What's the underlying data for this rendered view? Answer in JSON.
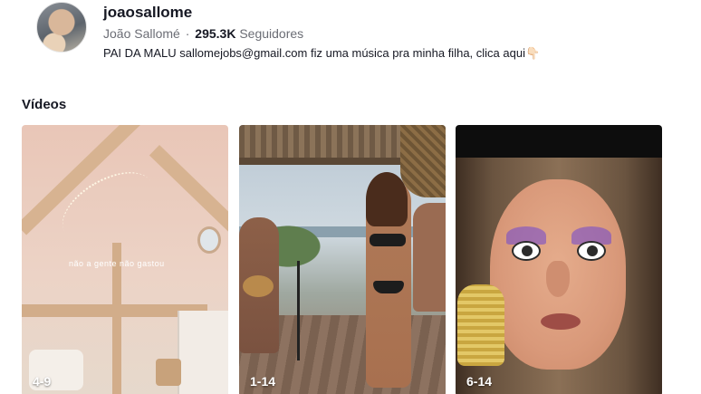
{
  "profile": {
    "username": "joaosallome",
    "display_name": "João  Sallomé",
    "separator": "·",
    "followers_count": "295.3K",
    "followers_label": "Seguidores",
    "bio": "PAI DA MALU sallomejobs@gmail.com fiz uma música pra minha filha, clica aqui👇🏻"
  },
  "videos": {
    "section_title": "Vídeos",
    "items": [
      {
        "label": "4-9",
        "overlay_text": "não a gente não gastou"
      },
      {
        "label": "1-14"
      },
      {
        "label": "6-14"
      }
    ]
  }
}
